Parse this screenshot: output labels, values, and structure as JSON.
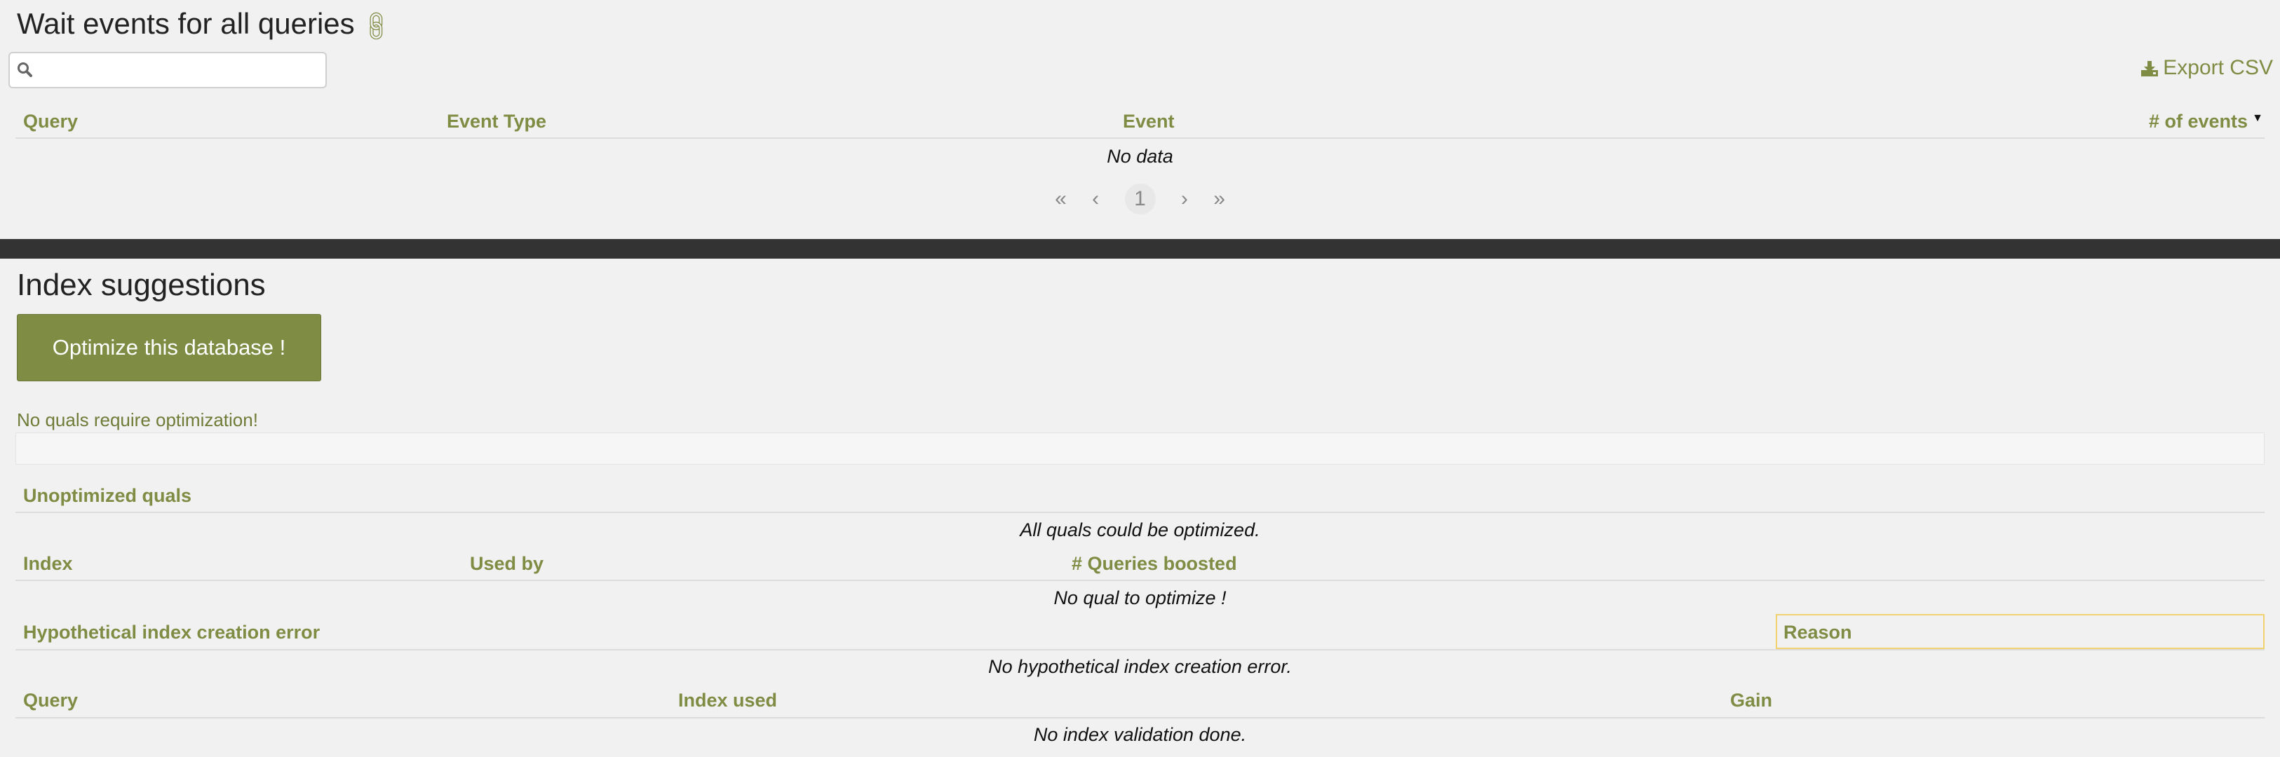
{
  "wait_events": {
    "title": "Wait events for all queries",
    "search": {
      "value": "",
      "placeholder": ""
    },
    "export_label": "Export CSV",
    "columns": [
      "Query",
      "Event Type",
      "Event",
      "# of events"
    ],
    "empty_text": "No data",
    "pager": {
      "first": "«",
      "prev": "‹",
      "current": "1",
      "next": "›",
      "last": "»"
    }
  },
  "index_suggestions": {
    "title": "Index suggestions",
    "optimize_button": "Optimize this database !",
    "status_text": "No quals require optimization!",
    "unoptimized": {
      "header": "Unoptimized quals",
      "empty_text": "All quals could be optimized."
    },
    "indexes": {
      "columns": [
        "Index",
        "Used by",
        "# Queries boosted"
      ],
      "empty_text": "No qual to optimize !"
    },
    "errors": {
      "columns": [
        "Hypothetical index creation error",
        "Reason"
      ],
      "empty_text": "No hypothetical index creation error."
    },
    "validation": {
      "columns": [
        "Query",
        "Index used",
        "Gain"
      ],
      "empty_text": "No index validation done."
    }
  },
  "colors": {
    "accent": "#7f8c44",
    "band": "#333333",
    "background": "#f1f1f1"
  }
}
